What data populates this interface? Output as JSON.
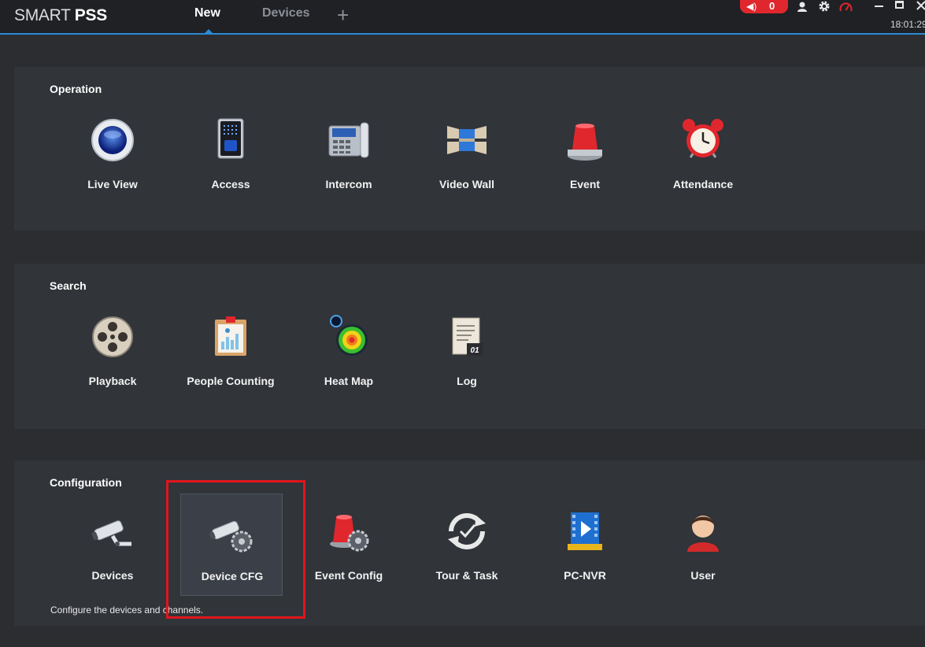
{
  "app": {
    "logo_light": "SMART",
    "logo_bold": "PSS"
  },
  "tabs": [
    {
      "label": "New",
      "active": true
    },
    {
      "label": "Devices",
      "active": false
    }
  ],
  "titlebar": {
    "add_tab_glyph": "+",
    "alarm_count": "0",
    "clock": "18:01:29",
    "icons": [
      "speaker-icon",
      "user-icon",
      "gear-icon",
      "performance-icon",
      "minimize-icon",
      "maximize-icon",
      "close-icon"
    ]
  },
  "sections": {
    "operation": {
      "title": "Operation",
      "items": [
        {
          "label": "Live View",
          "icon": "live-view-icon"
        },
        {
          "label": "Access",
          "icon": "access-icon"
        },
        {
          "label": "Intercom",
          "icon": "intercom-icon"
        },
        {
          "label": "Video Wall",
          "icon": "video-wall-icon"
        },
        {
          "label": "Event",
          "icon": "event-icon"
        },
        {
          "label": "Attendance",
          "icon": "attendance-icon"
        }
      ]
    },
    "search": {
      "title": "Search",
      "items": [
        {
          "label": "Playback",
          "icon": "playback-icon"
        },
        {
          "label": "People Counting",
          "icon": "people-counting-icon"
        },
        {
          "label": "Heat Map",
          "icon": "heat-map-icon"
        },
        {
          "label": "Log",
          "icon": "log-icon"
        }
      ]
    },
    "configuration": {
      "title": "Configuration",
      "items": [
        {
          "label": "Devices",
          "icon": "devices-icon"
        },
        {
          "label": "Device CFG",
          "icon": "device-cfg-icon",
          "selected": true
        },
        {
          "label": "Event Config",
          "icon": "event-config-icon"
        },
        {
          "label": "Tour & Task",
          "icon": "tour-task-icon"
        },
        {
          "label": "PC-NVR",
          "icon": "pc-nvr-icon"
        },
        {
          "label": "User",
          "icon": "user-icon"
        }
      ],
      "hint": "Configure the devices and channels."
    }
  },
  "colors": {
    "accent": "#2a8ad4",
    "alarm": "#e0272d",
    "highlight_box": "#e0151c",
    "panel": "#313439",
    "background": "#2b2d31"
  },
  "log_icon_text": "01"
}
